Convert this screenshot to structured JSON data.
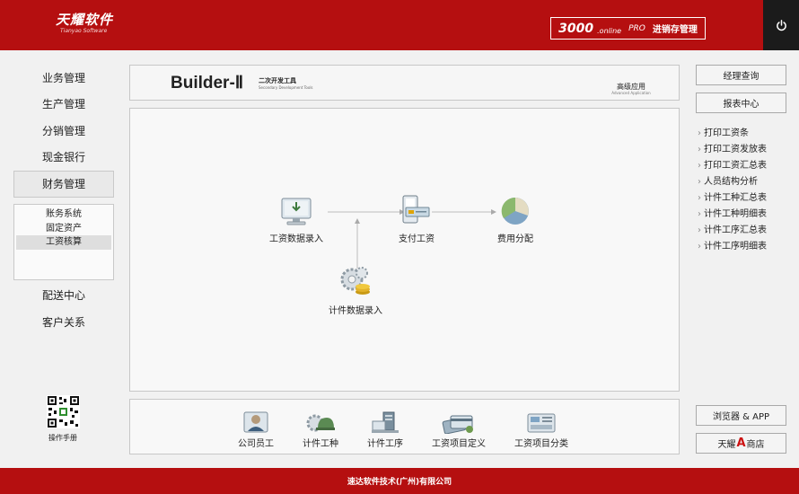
{
  "header": {
    "logo_cn": "天耀软件",
    "logo_en": "Tianyao Software",
    "product_num": "3000",
    "product_suffix": ".online",
    "product_pro": "PRO",
    "product_name": "进销存管理"
  },
  "nav": {
    "items": [
      "业务管理",
      "生产管理",
      "分销管理",
      "现金银行",
      "财务管理"
    ],
    "items2": [
      "配送中心",
      "客户关系"
    ],
    "sub": [
      "账务系统",
      "固定资产",
      "工资核算"
    ]
  },
  "qr": {
    "label": "操作手册"
  },
  "banner": {
    "title": "Builder-Ⅱ",
    "cn": "二次开发工具",
    "en": "Secondary Development Tools",
    "adv": "高级应用",
    "adv_en": "Advanced Application"
  },
  "flow": {
    "n1": "工资数据录入",
    "n2": "支付工资",
    "n3": "费用分配",
    "n4": "计件数据录入"
  },
  "dock": [
    "公司员工",
    "计件工种",
    "计件工序",
    "工资项目定义",
    "工资项目分类"
  ],
  "right": {
    "btn1": "经理查询",
    "btn2": "报表中心",
    "links": [
      "打印工资条",
      "打印工资发放表",
      "打印工资汇总表",
      "人员结构分析",
      "计件工种汇总表",
      "计件工种明细表",
      "计件工序汇总表",
      "计件工序明细表"
    ],
    "btn3": "浏览器 & APP",
    "btn4_a": "天耀",
    "btn4_b": "A",
    "btn4_c": "商店"
  },
  "footer": {
    "text": "速达软件技术(广州)有限公司"
  },
  "colors": {
    "brand": "#b50f10",
    "accent_a": "#cc1111"
  }
}
